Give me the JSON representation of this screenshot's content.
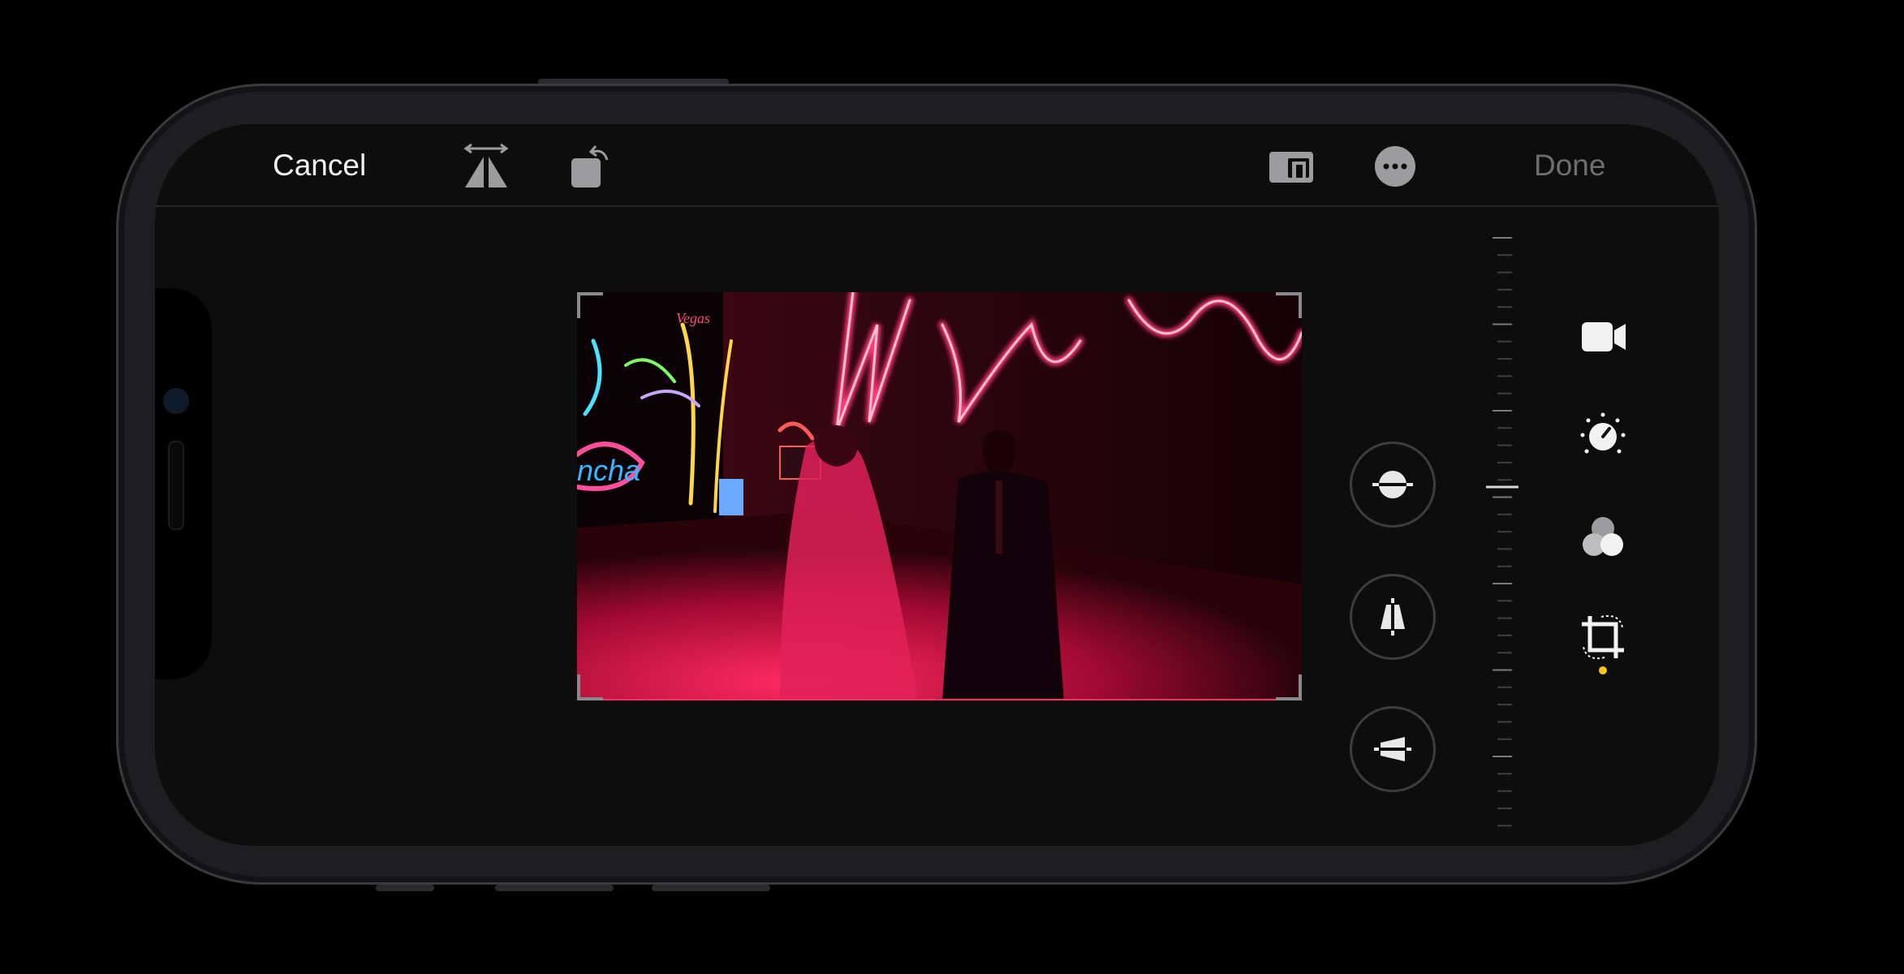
{
  "toolbar": {
    "cancel_label": "Cancel",
    "done_label": "Done",
    "icons": [
      "flip-icon",
      "rotate-icon",
      "aspect-ratio-icon",
      "more-icon"
    ]
  },
  "adjustments": {
    "buttons": [
      "straighten-icon",
      "vertical-perspective-icon",
      "horizontal-perspective-icon"
    ],
    "selected": "straighten-icon",
    "slider_value": 0
  },
  "sidebar": {
    "modes": [
      "video-icon",
      "adjust-icon",
      "filters-icon",
      "crop-icon"
    ],
    "active": "crop-icon",
    "active_dot_color": "#f5c518"
  },
  "colors": {
    "accent_neon": "#ff1f5a",
    "text_primary": "#f2f2f2",
    "text_disabled": "#6e6e70"
  }
}
